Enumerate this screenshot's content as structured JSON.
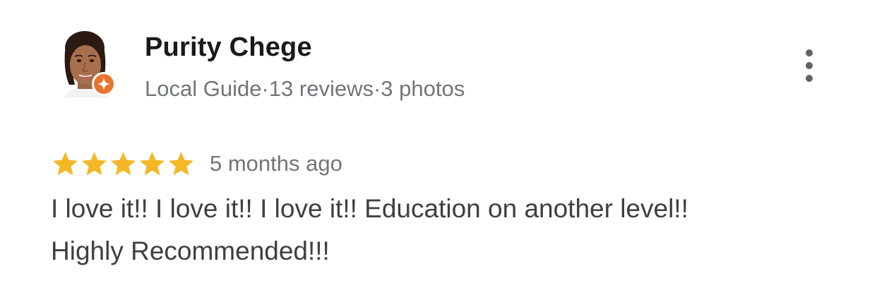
{
  "reviewer": {
    "name": "Purity Chege",
    "meta_parts": [
      "Local Guide",
      "13 reviews",
      "3 photos"
    ],
    "separator": "·",
    "badge_icon": "local-guide-star-icon",
    "badge_color": "#e8742c"
  },
  "review": {
    "rating": 5,
    "rating_max": 5,
    "star_color": "#f4b826",
    "date": "5 months ago",
    "text_lines": [
      "I love it!! I love it!! I love it!! Education on another level!!",
      "Highly Recommended!!!"
    ]
  },
  "actions": {
    "more_icon": "more-vertical-icon"
  }
}
